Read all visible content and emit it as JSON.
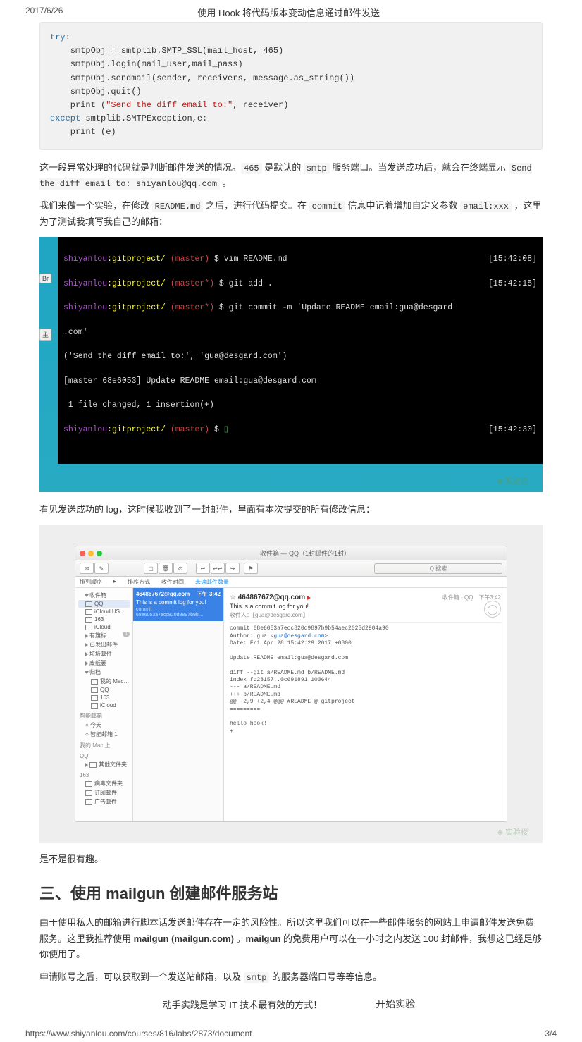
{
  "header": {
    "date": "2017/6/26",
    "title": "使用 Hook 将代码版本变动信息通过邮件发送"
  },
  "code_block": {
    "line1_kw": "try",
    "line1_colon": ":",
    "line2": "    smtpObj = smtplib.SMTP_SSL(mail_host, 465)",
    "line3": "    smtpObj.login(mail_user,mail_pass)",
    "line4": "    smtpObj.sendmail(sender, receivers, message.as_string())",
    "line5": "    smtpObj.quit()",
    "line6a": "    print (",
    "line6b": "\"Send the diff email to:\"",
    "line6c": ", receiver)",
    "line7_kw": "except",
    "line7_rest": " smtplib.SMTPException,e:",
    "line8a": "    print (",
    "line8b": "e)"
  },
  "paragraphs": {
    "p1_a": "这一段异常处理的代码就是判断邮件发送的情况。",
    "p1_code1": "465",
    "p1_b": " 是默认的 ",
    "p1_code2": "smtp",
    "p1_c": " 服务端口。当发送成功后，就会在终端显示 ",
    "p1_code3": "Send the diff email to: shiyanlou@qq.com",
    "p1_d": " 。",
    "p2_a": "我们来做一个实验，在修改 ",
    "p2_code1": "README.md",
    "p2_b": " 之后，进行代码提交。在 ",
    "p2_code2": "commit",
    "p2_c": " 信息中记着增加自定义参数 ",
    "p2_code3": "email:xxx",
    "p2_d": " ，这里为了测试我填写我自己的邮箱：",
    "p3": "看见发送成功的 log，这时候我收到了一封邮件，里面有本次提交的所有修改信息：",
    "p4": "是不是很有趣。",
    "p5_a": "由于使用私人的邮箱进行脚本话发送邮件存在一定的风险性。所以这里我们可以在一些邮件服务的网站上申请邮件发送免费服务。这里我推荐使用 ",
    "p5_link": "mailgun (mailgun.com)",
    "p5_b": " 。",
    "p5_bold": "mailgun",
    "p5_c": " 的免费用户可以在一小时之内发送 100 封邮件，我想这已经足够你使用了。",
    "p6_a": "申请账号之后，可以获取到一个发送站邮箱，以及 ",
    "p6_code": "smtp",
    "p6_b": " 的服务器端口号等等信息。"
  },
  "terminal": {
    "side_btn1": "Br",
    "side_btn2": "主",
    "l1_user": "shiyanlou",
    "l1_path": ":gitproject/",
    "l1_branch": " (master) ",
    "l1_cmd": "$ vim README.md",
    "l1_time": "[15:42:08]",
    "l2_user": "shiyanlou",
    "l2_path": ":gitproject/",
    "l2_branch": " (master*) ",
    "l2_cmd": "$ git add .",
    "l2_time": "[15:42:15]",
    "l3_user": "shiyanlou",
    "l3_path": ":gitproject/",
    "l3_branch": " (master*) ",
    "l3_cmd": "$ git commit -m 'Update README email:gua@desgard",
    "l4": ".com'",
    "l5": "('Send the diff email to:', 'gua@desgard.com')",
    "l6": "[master 68e6053] Update README email:gua@desgard.com",
    "l7": " 1 file changed, 1 insertion(+)",
    "l8_user": "shiyanlou",
    "l8_path": ":gitproject/",
    "l8_branch": " (master) ",
    "l8_cmd": "$ ",
    "l8_time": "[15:42:30]",
    "watermark": "◈ 实验楼"
  },
  "mail": {
    "title": "收件箱 — QQ（1封邮件的1封）",
    "search": "Q 搜索",
    "bar2_left": "排列顺序",
    "bar2_a": "排序方式",
    "bar2_b": "收件时间",
    "bar2_c": "未读邮件数量",
    "sb_mailboxes": "收件箱",
    "sb_qq": "QQ",
    "sb_icloudus": "iCloud US.",
    "sb_163": "163",
    "sb_icloud": "iCloud",
    "sb_flagged": "有旗标",
    "sb_drafts": "已发出邮件",
    "sb_junk": "垃圾邮件",
    "sb_archive": "废纸篓",
    "sb_archive2": "归档",
    "sb_onmac": "我的 Mac 上",
    "sb_sec_tag": "智能邮箱",
    "sb_today": "今天",
    "sb_smart1": "智能邮箱 1",
    "sb_sec_mac": "我的 Mac 上",
    "sb_sec_qq2": "QQ",
    "sb_other1": "其他文件夹",
    "sb_sec_163": "163",
    "sb_junk2": "病毒文件夹",
    "sb_sub1": "订阅邮件",
    "sb_ad": "广告邮件",
    "list_from": "464867672@qq.com",
    "list_time": "下午 3:42",
    "list_subject": "This is a commit log for you!",
    "list_preview": "commit 68e6053a7ecc820d9897b9b…",
    "mv_from": "464867672@qq.com",
    "mv_inbox": "收件箱 - QQ",
    "mv_time": "下午3:42",
    "mv_subject": "This is a commit log for you!",
    "mv_to_label": "收件人：",
    "mv_to": "【gua@desgard.com】",
    "mv_line1": "commit 68e6053a7ecc820d9897b9b54aec2025d2904a90",
    "mv_line2": "Author: gua <",
    "mv_line2_link": "gua@desgard.com",
    "mv_line2_end": ">",
    "mv_line3": "Date:   Fri Apr 28 15:42:29 2017 +0800",
    "mv_line4": "    Update README email:gua@desgard.com",
    "mv_line5": "diff --git a/README.md b/README.md",
    "mv_line6": "index fd28157..0c691891 100644",
    "mv_line7": "--- a/README.md",
    "mv_line8": "+++ b/README.md",
    "mv_line9": "@@ -2,9 +2,4 @@@ #README @ gitproject",
    "mv_line10": "=========",
    "mv_line11": "hello hook!",
    "mv_line12": "+",
    "watermark": "◈ 实验楼"
  },
  "section_title": "三、使用 mailgun 创建邮件服务站",
  "cta": {
    "text": "动手实践是学习 IT 技术最有效的方式！",
    "button": "开始实验"
  },
  "footer": {
    "url": "https://www.shiyanlou.com/courses/816/labs/2873/document",
    "page": "3/4"
  }
}
